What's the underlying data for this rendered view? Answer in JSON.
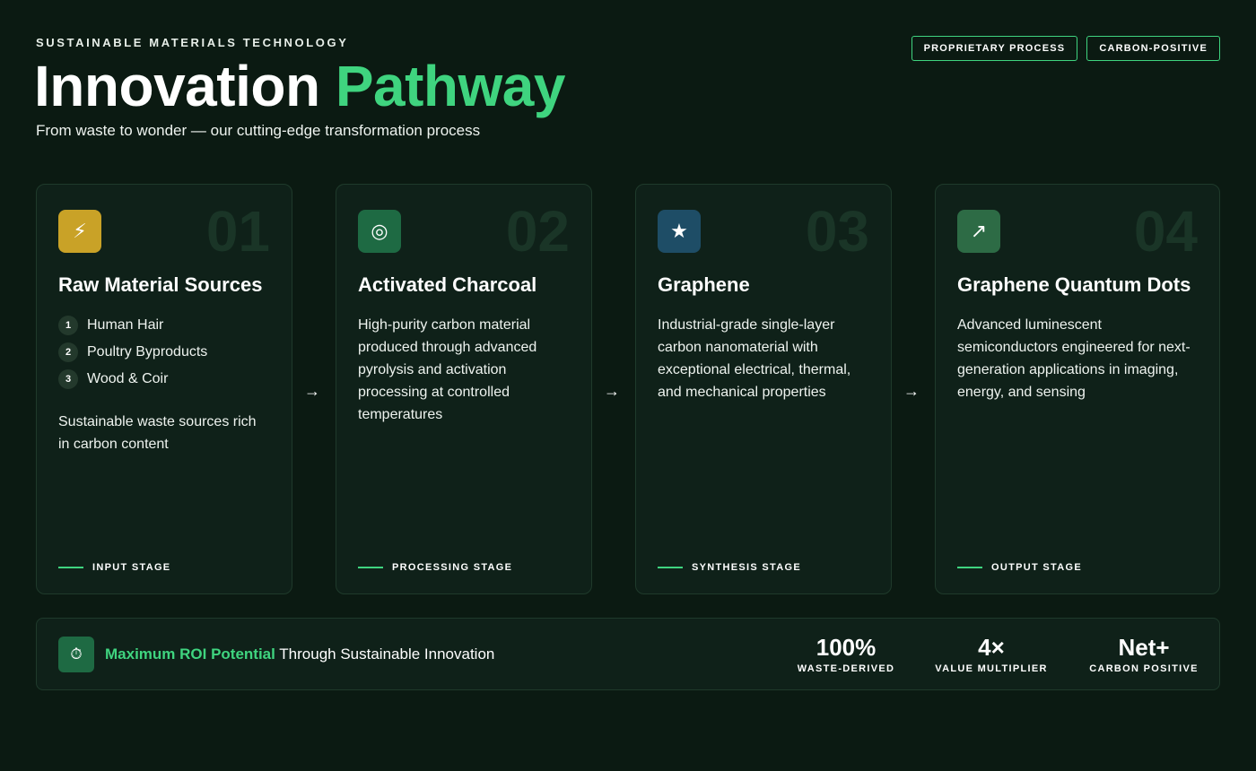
{
  "header": {
    "eyebrow": "SUSTAINABLE MATERIALS TECHNOLOGY",
    "title_main": "Innovation",
    "title_accent": "Pathway",
    "subtitle": "From waste to wonder — our cutting-edge transformation process",
    "badges": [
      "PROPRIETARY PROCESS",
      "CARBON-POSITIVE"
    ]
  },
  "colors": {
    "background": "#0b1a12",
    "card": "#0f2119",
    "accent": "#3fd47f",
    "icon_1": "#c9a227",
    "icon_2": "#1e6a43",
    "icon_3": "#1e4d66",
    "icon_4": "#2d6b45"
  },
  "stages": [
    {
      "icon": "lightning-icon",
      "icon_glyph": "⚡",
      "number": "01",
      "title": "Raw Material Sources",
      "items": [
        {
          "num": "1",
          "label": "Human Hair"
        },
        {
          "num": "2",
          "label": "Poultry Byproducts"
        },
        {
          "num": "3",
          "label": "Wood & Coir"
        }
      ],
      "description": "Sustainable waste sources rich in carbon content",
      "stage_label": "INPUT STAGE"
    },
    {
      "icon": "target-icon",
      "icon_glyph": "◎",
      "number": "02",
      "title": "Activated Charcoal",
      "description": "High-purity carbon material produced through advanced pyrolysis and activation processing at controlled temperatures",
      "stage_label": "PROCESSING STAGE"
    },
    {
      "icon": "star-icon",
      "icon_glyph": "★",
      "number": "03",
      "title": "Graphene",
      "description": "Industrial-grade single-layer carbon nanomaterial with exceptional electrical, thermal, and mechanical properties",
      "stage_label": "SYNTHESIS STAGE"
    },
    {
      "icon": "arrow-up-right-icon",
      "icon_glyph": "↗",
      "number": "04",
      "title": "Graphene Quantum Dots",
      "description": "Advanced luminescent semiconductors engineered for next-generation applications in imaging, energy, and sensing",
      "stage_label": "OUTPUT STAGE"
    }
  ],
  "arrow_glyph": "→",
  "footer": {
    "icon": "stopwatch-icon",
    "icon_glyph": "⏱",
    "highlight": "Maximum ROI Potential",
    "text": " Through Sustainable Innovation",
    "stats": [
      {
        "value": "100%",
        "label": "WASTE-DERIVED"
      },
      {
        "value": "4×",
        "label": "VALUE MULTIPLIER"
      },
      {
        "value": "Net+",
        "label": "CARBON POSITIVE"
      }
    ]
  }
}
